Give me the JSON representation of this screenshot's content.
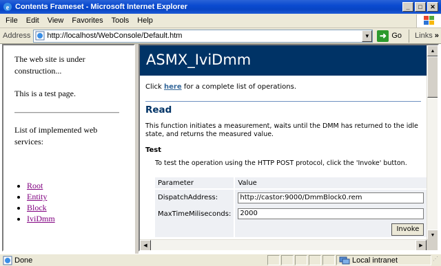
{
  "window": {
    "title": "Contents Frameset - Microsoft Internet Explorer",
    "min_glyph": "_",
    "max_glyph": "□",
    "close_glyph": "✕"
  },
  "menu": {
    "items": [
      "File",
      "Edit",
      "View",
      "Favorites",
      "Tools",
      "Help"
    ]
  },
  "address_bar": {
    "label": "Address",
    "url": "http://localhost/WebConsole/Default.htm",
    "go_label": "Go",
    "links_label": "Links",
    "links_chevron": "»"
  },
  "left_frame": {
    "intro": "The web site is under construction...",
    "test_note": "This is a test page.",
    "list_heading": "List of implemented web services:",
    "links": [
      "Root",
      "Entity",
      "Block",
      "IviDmm"
    ]
  },
  "right_frame": {
    "banner": "ASMX_IviDmm",
    "click_prefix": "Click ",
    "click_link": "here",
    "click_suffix": " for a complete list of operations.",
    "operation_title": "Read",
    "operation_desc": "This function initiates a measurement, waits until the DMM has returned to the idle state, and returns the measured value.",
    "test_heading": "Test",
    "test_desc": "To test the operation using the HTTP POST protocol, click the 'Invoke' button.",
    "table": {
      "col_param": "Parameter",
      "col_value": "Value",
      "rows": [
        {
          "name": "DispatchAddress:",
          "value": "http://castor:9000/DmmBlock0.rem"
        },
        {
          "name": "MaxTimeMiliseconds:",
          "value": "2000"
        }
      ],
      "invoke_label": "Invoke"
    }
  },
  "status_bar": {
    "text": "Done",
    "zone": "Local intranet"
  },
  "colors": {
    "title_bar": "#0a4ad0",
    "banner": "#003366",
    "section_title": "#003366",
    "here_link": "#336699",
    "visited_link": "#800080",
    "param_table_bg": "#eef0f4"
  }
}
